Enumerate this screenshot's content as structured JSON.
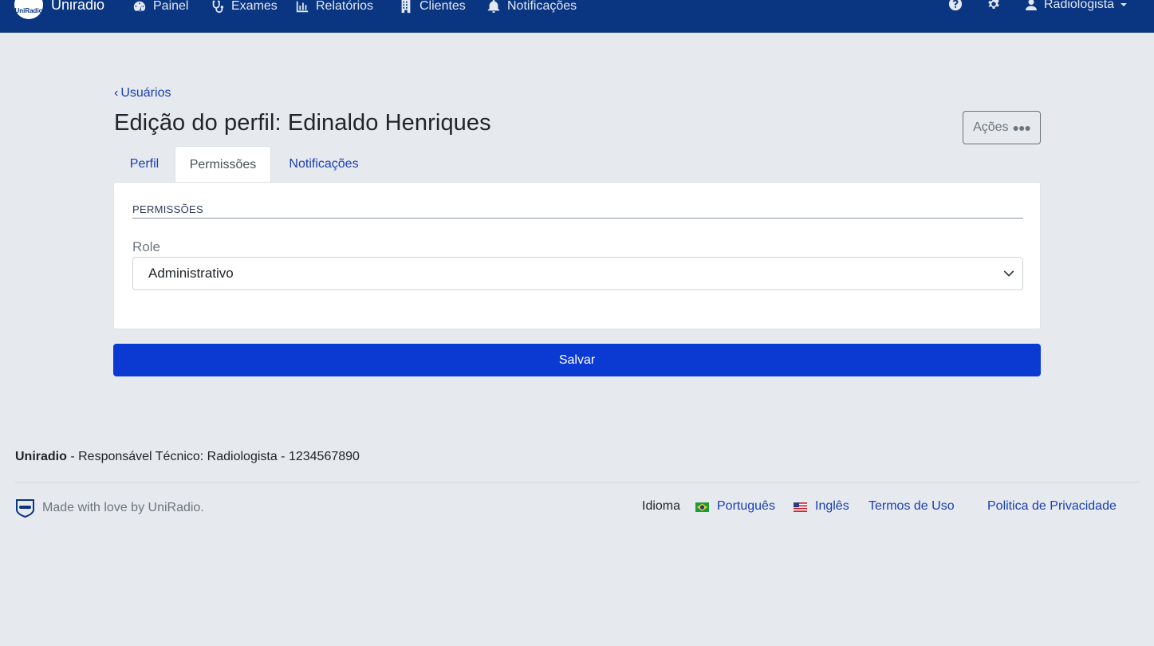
{
  "navbar": {
    "brand_logo_text": "UniRadio",
    "brand_name": "Uniradio",
    "items": [
      {
        "label": "Painel",
        "icon": "dashboard-icon"
      },
      {
        "label": "Exames",
        "icon": "stethoscope-icon"
      },
      {
        "label": "Relatórios",
        "icon": "bar-chart-icon"
      },
      {
        "label": "Clientes",
        "icon": "building-icon"
      },
      {
        "label": "Notificações",
        "icon": "bell-icon"
      }
    ],
    "help_icon": "question-circle-icon",
    "settings_icon": "gear-icon",
    "user": {
      "label": "Radiologista",
      "icon": "user-icon"
    },
    "colors": {
      "background": "#0a3681",
      "badge": "#f4c21d"
    }
  },
  "page": {
    "back_label": "Usuários",
    "title": "Edição do perfil: Edinaldo Henriques",
    "actions_label": "Ações",
    "tabs": [
      {
        "label": "Perfil",
        "active": false
      },
      {
        "label": "Permissões",
        "active": true
      },
      {
        "label": "Notificações",
        "active": false
      }
    ],
    "section_legend": "PERMISSÕES",
    "role_label": "Role",
    "role_value": "Administrativo",
    "save_label": "Salvar",
    "colors": {
      "link": "#1a3fb0",
      "primary": "#0b3ad3",
      "background": "#e6e9ee"
    }
  },
  "footer": {
    "brand": "Uniradio",
    "responsible": " - Responsável Técnico: Radiologista - 1234567890",
    "made_with": "Made with love by UniRadio.",
    "idioma_label": "Idioma",
    "lang_pt": "Português",
    "lang_en": "Inglês",
    "terms": "Termos de Uso",
    "privacy": "Politica de Privacidade"
  }
}
